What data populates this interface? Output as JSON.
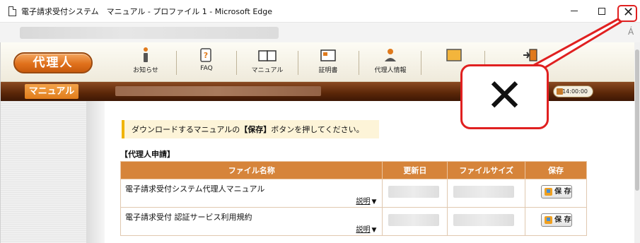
{
  "window": {
    "title": "電子請求受付システム　マニュアル - プロファイル 1 - Microsoft Edge",
    "minimize_glyph": "—",
    "maximize_glyph": "□",
    "close_glyph": "✕"
  },
  "addressbar": {
    "read_aloud_glyph": "Á"
  },
  "nav": {
    "role_label": "代理人",
    "items": [
      {
        "label": "お知らせ",
        "icon": "info-icon"
      },
      {
        "label": "FAQ",
        "icon": "faq-icon"
      },
      {
        "label": "マニュアル",
        "icon": "book-icon"
      },
      {
        "label": "証明書",
        "icon": "certificate-icon"
      },
      {
        "label": "代理人情報",
        "icon": "person-icon"
      },
      {
        "label": "",
        "icon": "id-card-icon"
      },
      {
        "label": "",
        "icon": "logout-icon"
      }
    ]
  },
  "section": {
    "title": "マニュアル",
    "time": "14:00:00"
  },
  "notice": {
    "prefix": "ダウンロードするマニュアルの",
    "bold": "【保存】",
    "suffix": "ボタンを押してください。"
  },
  "group_heading": "【代理人申請】",
  "table": {
    "headers": [
      "ファイル名称",
      "更新日",
      "ファイルサイズ",
      "保存"
    ],
    "rows": [
      {
        "name": "電子請求受付システム代理人マニュアル",
        "desc": "説明",
        "save": "保 存"
      },
      {
        "name": "電子請求受付 認証サービス利用規約",
        "desc": "説明",
        "save": "保 存"
      }
    ]
  },
  "callout": {
    "glyph": "✕"
  },
  "colors": {
    "accent_red": "#e02020",
    "brand_orange": "#e0711c",
    "header_brown": "#5a2608",
    "table_header": "#d6843a"
  }
}
